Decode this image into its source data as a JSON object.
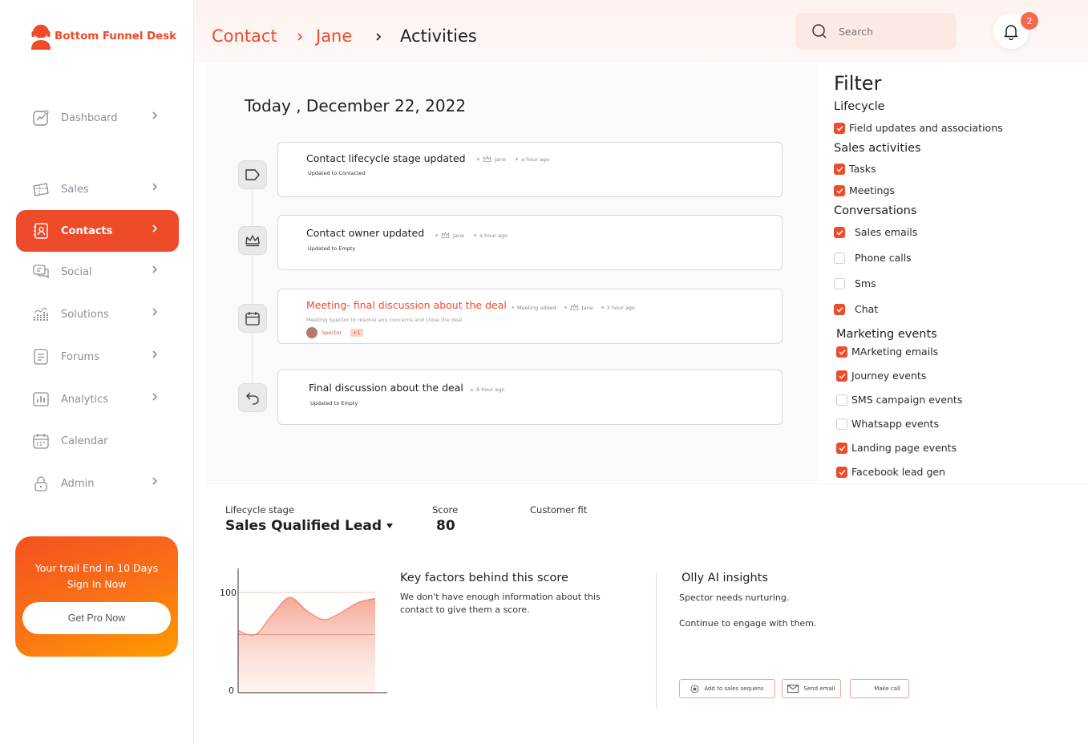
{
  "brand": {
    "name": "Bottom Funnel Desk",
    "color": "#ee4b2b"
  },
  "sidebar": {
    "items": [
      {
        "label": "Dashboard",
        "icon": "chart-line-icon",
        "has_chevron": true,
        "active": false
      },
      {
        "label": "Sales",
        "icon": "ticket-icon",
        "has_chevron": true,
        "active": false
      },
      {
        "label": "Contacts",
        "icon": "contacts-icon",
        "has_chevron": true,
        "active": true
      },
      {
        "label": "Social",
        "icon": "chat-icon",
        "has_chevron": true,
        "active": false
      },
      {
        "label": "Solutions",
        "icon": "bar-chart-icon",
        "has_chevron": true,
        "active": false
      },
      {
        "label": "Forums",
        "icon": "document-icon",
        "has_chevron": true,
        "active": false
      },
      {
        "label": "Analytics",
        "icon": "analytics-icon",
        "has_chevron": true,
        "active": false
      },
      {
        "label": "Calendar",
        "icon": "calendar-icon",
        "has_chevron": false,
        "active": false
      },
      {
        "label": "Admin",
        "icon": "lock-icon",
        "has_chevron": true,
        "active": false
      }
    ],
    "promo": {
      "line1": "Your trail End in 10 Days",
      "line2": "Sign In Now",
      "button": "Get Pro Now"
    }
  },
  "header": {
    "breadcrumb": [
      "Contact",
      "Jane",
      "Activities"
    ],
    "search_placeholder": "Search",
    "notification_count": "2"
  },
  "activity": {
    "date_title": "Today , December 22, 2022",
    "items": [
      {
        "icon": "tag-icon",
        "title": "Contact lifecycle stage updated",
        "author": "Jane",
        "time": "a hour ago",
        "sub_prefix": "Updated to",
        "sub_value": "Contacted"
      },
      {
        "icon": "crown-icon",
        "title": "Contact owner updated",
        "author": "Jane",
        "time": "a hour ago",
        "sub_prefix": "Updated to",
        "sub_value": "Empty"
      },
      {
        "icon": "calendar-icon",
        "title": "Meeting- final discussion about the deal",
        "tag": "Meeting added",
        "author": "Jane",
        "time": "3 hour ago",
        "sub": "Meeting Spector to resolve any concerns and close the deal",
        "attendee": "Spector",
        "attendee_extra": "+1"
      },
      {
        "icon": "undo-icon",
        "title": "Final discussion about the deal",
        "time": "8 hour ago",
        "sub_prefix": "Updated to",
        "sub_value": "Empty"
      }
    ]
  },
  "filter": {
    "title": "Filter",
    "sections": [
      {
        "title": "Lifecycle",
        "items": [
          {
            "label": "Field updates and associations",
            "checked": true
          }
        ]
      },
      {
        "title": "Sales activities",
        "items": [
          {
            "label": "Tasks",
            "checked": true
          },
          {
            "label": "Meetings",
            "checked": true
          }
        ]
      },
      {
        "title": "Conversations",
        "items": [
          {
            "label": "Sales emails",
            "checked": true
          },
          {
            "label": "Phone calls",
            "checked": false
          },
          {
            "label": "Sms",
            "checked": false
          },
          {
            "label": "Chat",
            "checked": true
          }
        ]
      },
      {
        "title": "Marketing events",
        "items": [
          {
            "label": "MArketing emails",
            "checked": true
          },
          {
            "label": "Journey events",
            "checked": true
          },
          {
            "label": "SMS campaign events",
            "checked": false
          },
          {
            "label": "Whatsapp events",
            "checked": false
          },
          {
            "label": "Landing page events",
            "checked": true
          },
          {
            "label": "Facebook lead gen",
            "checked": true
          }
        ]
      }
    ]
  },
  "summary": {
    "lifecycle_label": "Lifecycle stage",
    "lifecycle_value": "Sales Qualified Lead",
    "score_label": "Score",
    "score_value": "80",
    "fit_label": "Customer fit"
  },
  "chart_data": {
    "type": "area",
    "x": [
      0,
      1,
      2,
      3,
      4,
      5,
      6,
      7,
      8
    ],
    "series": [
      {
        "values": [
          62,
          58,
          78,
          95,
          82,
          73,
          80,
          90,
          94
        ]
      }
    ],
    "reference_line": 58,
    "yticks": [
      "100",
      "0"
    ],
    "ylim": [
      0,
      100
    ],
    "grid": false,
    "fill_color": "#f4a492",
    "line_color": "#ee4b2b"
  },
  "key_factors": {
    "title": "Key factors behind this score",
    "body": "We don't have enough information about this contact to give them a score."
  },
  "insights": {
    "title": "Olly AI insights",
    "line1": "Spector needs nurturing.",
    "line2": "Continue to engage with them.",
    "buttons": [
      "Add to sales sequens",
      "Send email",
      "Make call"
    ]
  }
}
